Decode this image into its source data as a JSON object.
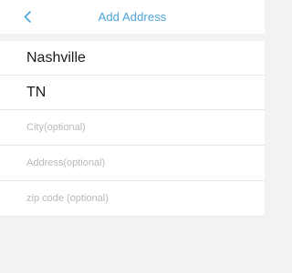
{
  "nav": {
    "title": "Add Address",
    "back_icon": "chevron-left-icon",
    "accent_color": "#4aa3d8"
  },
  "form": {
    "country": "Nashville",
    "state": "TN",
    "city": {
      "value": "",
      "placeholder": "City(optional)"
    },
    "address": {
      "value": "",
      "placeholder": "Address(optional)"
    },
    "zip": {
      "value": "",
      "placeholder": "zip code (optional)"
    }
  }
}
